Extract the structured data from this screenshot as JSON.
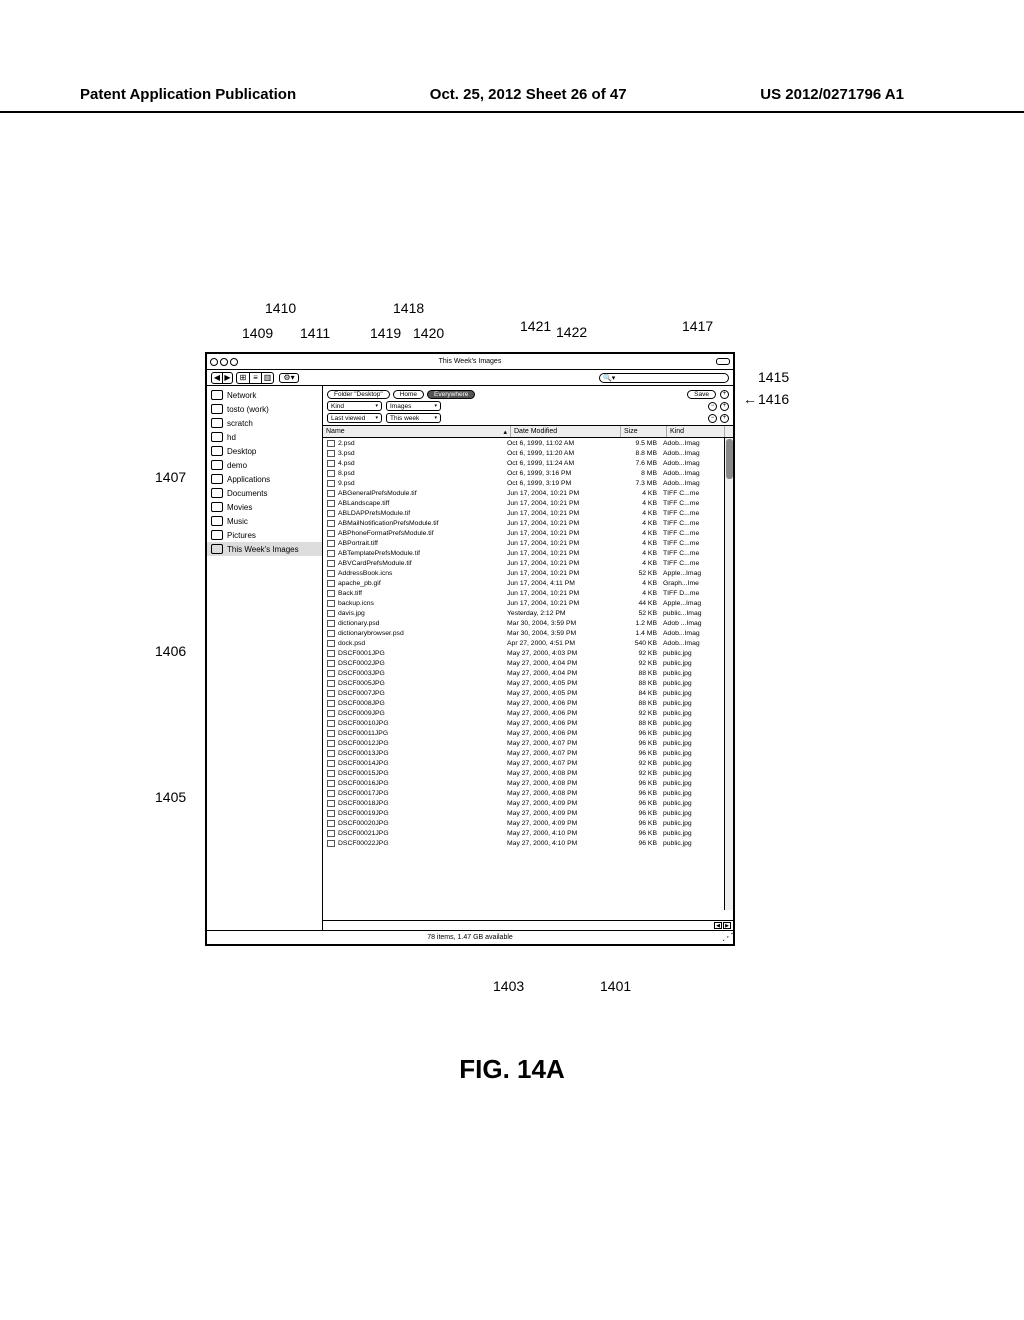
{
  "header": {
    "left": "Patent Application Publication",
    "center": "Oct. 25, 2012  Sheet 26 of 47",
    "right": "US 2012/0271796 A1"
  },
  "figure_label": "FIG. 14A",
  "callouts": {
    "c1410": "1410",
    "c1418": "1418",
    "c1409": "1409",
    "c1411": "1411",
    "c1419": "1419",
    "c1420": "1420",
    "c1421": "1421",
    "c1422": "1422",
    "c1417": "1417",
    "c1415": "1415",
    "c1416": "1416",
    "c1407": "1407",
    "c1406": "1406",
    "c1405": "1405",
    "c1403": "1403",
    "c1401": "1401"
  },
  "window": {
    "title": "This Week's Images",
    "toolbar": {
      "search_placeholder": ""
    },
    "sidebar": [
      {
        "label": "Network",
        "icon": "globe"
      },
      {
        "label": "tosto (work)",
        "icon": "disk"
      },
      {
        "label": "scratch",
        "icon": "disk"
      },
      {
        "label": "hd",
        "icon": "disk"
      },
      {
        "label": "Desktop",
        "icon": "desktop"
      },
      {
        "label": "demo",
        "icon": "home"
      },
      {
        "label": "Applications",
        "icon": "app"
      },
      {
        "label": "Documents",
        "icon": "doc"
      },
      {
        "label": "Movies",
        "icon": "movie"
      },
      {
        "label": "Music",
        "icon": "music"
      },
      {
        "label": "Pictures",
        "icon": "pic"
      },
      {
        "label": "This Week's Images",
        "icon": "smart",
        "selected": true
      }
    ],
    "filterbar": {
      "scopes": [
        {
          "label": "Folder \"Desktop\"",
          "sel": false
        },
        {
          "label": "Home",
          "sel": false
        },
        {
          "label": "Everywhere",
          "sel": true
        }
      ],
      "save_label": "Save",
      "row2": {
        "attr": "Kind",
        "value": "Images"
      },
      "row3": {
        "attr": "Last viewed",
        "value": "This week"
      }
    },
    "columns": {
      "name": "Name",
      "date": "Date Modified",
      "size": "Size",
      "kind": "Kind"
    },
    "files": [
      {
        "n": "2.psd",
        "d": "Oct 6, 1999, 11:02 AM",
        "s": "9.5 MB",
        "k": "Adob...Imag"
      },
      {
        "n": "3.psd",
        "d": "Oct 6, 1999, 11:20 AM",
        "s": "8.8 MB",
        "k": "Adob...Imag"
      },
      {
        "n": "4.psd",
        "d": "Oct 6, 1999, 11:24 AM",
        "s": "7.6 MB",
        "k": "Adob...Imag"
      },
      {
        "n": "8.psd",
        "d": "Oct 6, 1999, 3:16 PM",
        "s": "8 MB",
        "k": "Adob...Imag"
      },
      {
        "n": "9.psd",
        "d": "Oct 6, 1999, 3:19 PM",
        "s": "7.3 MB",
        "k": "Adob...Imag"
      },
      {
        "n": "ABGeneralPrefsModule.tif",
        "d": "Jun 17, 2004, 10:21 PM",
        "s": "4 KB",
        "k": "TIFF C...me"
      },
      {
        "n": "ABLandscape.tiff",
        "d": "Jun 17, 2004, 10:21 PM",
        "s": "4 KB",
        "k": "TIFF C...me"
      },
      {
        "n": "ABLDAPPrefsModule.tif",
        "d": "Jun 17, 2004, 10:21 PM",
        "s": "4 KB",
        "k": "TIFF C...me"
      },
      {
        "n": "ABMailNotificationPrefsModule.tif",
        "d": "Jun 17, 2004, 10:21 PM",
        "s": "4 KB",
        "k": "TIFF C...me"
      },
      {
        "n": "ABPhoneFormatPrefsModule.tif",
        "d": "Jun 17, 2004, 10:21 PM",
        "s": "4 KB",
        "k": "TIFF C...me"
      },
      {
        "n": "ABPortrait.tiff",
        "d": "Jun 17, 2004, 10:21 PM",
        "s": "4 KB",
        "k": "TIFF C...me"
      },
      {
        "n": "ABTemplatePrefsModule.tif",
        "d": "Jun 17, 2004, 10:21 PM",
        "s": "4 KB",
        "k": "TIFF C...me"
      },
      {
        "n": "ABVCardPrefsModule.tif",
        "d": "Jun 17, 2004, 10:21 PM",
        "s": "4 KB",
        "k": "TIFF C...me"
      },
      {
        "n": "AddressBook.icns",
        "d": "Jun 17, 2004, 10:21 PM",
        "s": "52 KB",
        "k": "Apple...Imag"
      },
      {
        "n": "apache_pb.gif",
        "d": "Jun 17, 2004, 4:11 PM",
        "s": "4 KB",
        "k": "Graph...Ime"
      },
      {
        "n": "Back.tiff",
        "d": "Jun 17, 2004, 10:21 PM",
        "s": "4 KB",
        "k": "TIFF D...me"
      },
      {
        "n": "backup.icns",
        "d": "Jun 17, 2004, 10:21 PM",
        "s": "44 KB",
        "k": "Apple...Imag"
      },
      {
        "n": "davis.jpg",
        "d": "Yesterday, 2:12 PM",
        "s": "52 KB",
        "k": "public...Imag"
      },
      {
        "n": "dictionary.psd",
        "d": "Mar 30, 2004, 3:59 PM",
        "s": "1.2 MB",
        "k": "Adob ...Imag"
      },
      {
        "n": "dictionarybrowser.psd",
        "d": "Mar 30, 2004, 3:59 PM",
        "s": "1.4 MB",
        "k": "Adob...Imag"
      },
      {
        "n": "dock.psd",
        "d": "Apr 27, 2000, 4:51 PM",
        "s": "540 KB",
        "k": "Adob...Imag"
      },
      {
        "n": "DSCF0001JPG",
        "d": "May 27, 2000, 4:03 PM",
        "s": "92 KB",
        "k": "public.jpg"
      },
      {
        "n": "DSCF0002JPG",
        "d": "May 27, 2000, 4:04 PM",
        "s": "92 KB",
        "k": "public.jpg"
      },
      {
        "n": "DSCF0003JPG",
        "d": "May 27, 2000, 4:04 PM",
        "s": "88 KB",
        "k": "public.jpg"
      },
      {
        "n": "DSCF0005JPG",
        "d": "May 27, 2000, 4:05 PM",
        "s": "88 KB",
        "k": "public.jpg"
      },
      {
        "n": "DSCF0007JPG",
        "d": "May 27, 2000, 4:05 PM",
        "s": "84 KB",
        "k": "public.jpg"
      },
      {
        "n": "DSCF0008JPG",
        "d": "May 27, 2000, 4:06 PM",
        "s": "88 KB",
        "k": "public.jpg"
      },
      {
        "n": "DSCF0009JPG",
        "d": "May 27, 2000, 4:06 PM",
        "s": "92 KB",
        "k": "public.jpg"
      },
      {
        "n": "DSCF00010JPG",
        "d": "May 27, 2000, 4:06 PM",
        "s": "88 KB",
        "k": "public.jpg"
      },
      {
        "n": "DSCF00011JPG",
        "d": "May 27, 2000, 4:06 PM",
        "s": "96 KB",
        "k": "public.jpg"
      },
      {
        "n": "DSCF00012JPG",
        "d": "May 27, 2000, 4:07 PM",
        "s": "96 KB",
        "k": "public.jpg"
      },
      {
        "n": "DSCF00013JPG",
        "d": "May 27, 2000, 4:07 PM",
        "s": "96 KB",
        "k": "public.jpg"
      },
      {
        "n": "DSCF00014JPG",
        "d": "May 27, 2000, 4:07 PM",
        "s": "92 KB",
        "k": "public.jpg"
      },
      {
        "n": "DSCF00015JPG",
        "d": "May 27, 2000, 4:08 PM",
        "s": "92 KB",
        "k": "public.jpg"
      },
      {
        "n": "DSCF00016JPG",
        "d": "May 27, 2000, 4:08 PM",
        "s": "96 KB",
        "k": "public.jpg"
      },
      {
        "n": "DSCF00017JPG",
        "d": "May 27, 2000, 4:08 PM",
        "s": "96 KB",
        "k": "public.jpg"
      },
      {
        "n": "DSCF00018JPG",
        "d": "May 27, 2000, 4:09 PM",
        "s": "96 KB",
        "k": "public.jpg"
      },
      {
        "n": "DSCF00019JPG",
        "d": "May 27, 2000, 4:09 PM",
        "s": "96 KB",
        "k": "public.jpg"
      },
      {
        "n": "DSCF00020JPG",
        "d": "May 27, 2000, 4:09 PM",
        "s": "96 KB",
        "k": "public.jpg"
      },
      {
        "n": "DSCF00021JPG",
        "d": "May 27, 2000, 4:10 PM",
        "s": "96 KB",
        "k": "public.jpg"
      },
      {
        "n": "DSCF00022JPG",
        "d": "May 27, 2000, 4:10 PM",
        "s": "96 KB",
        "k": "public.jpg"
      }
    ],
    "status": "78 items, 1.47 GB available"
  }
}
